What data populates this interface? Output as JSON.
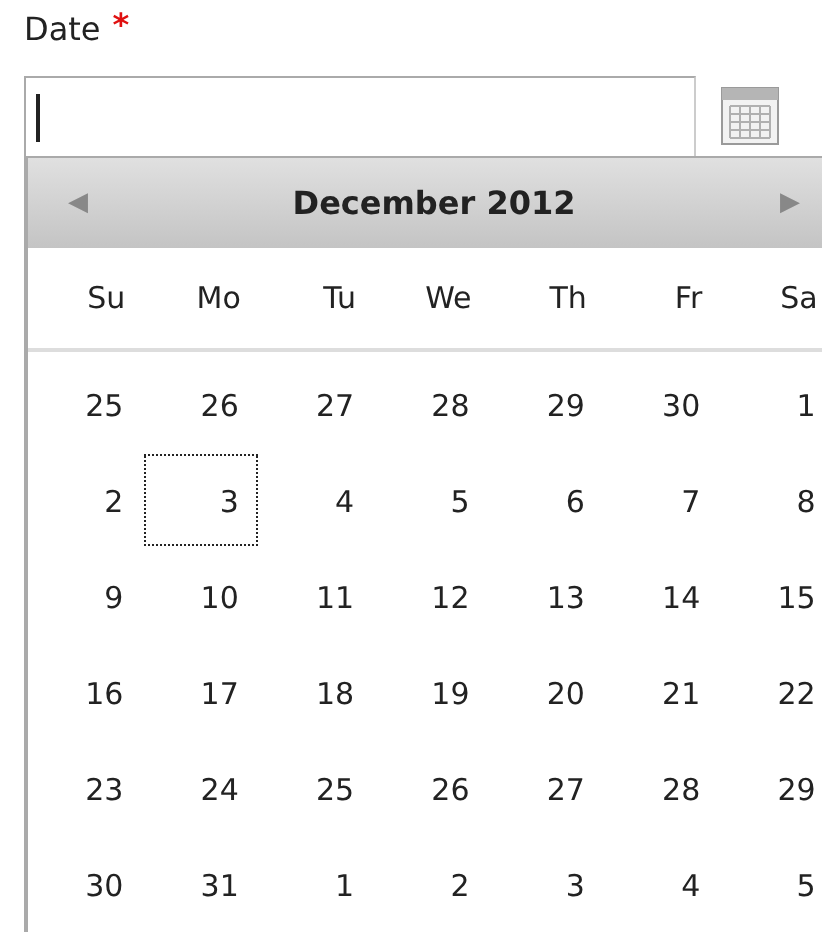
{
  "field": {
    "label": "Date",
    "required": true,
    "required_mark": "*"
  },
  "calendar": {
    "prev": "◀",
    "title": "December 2012",
    "next": "▶",
    "weekdays": [
      "Su",
      "Mo",
      "Tu",
      "We",
      "Th",
      "Fr",
      "Sa"
    ],
    "weeks": [
      [
        {
          "day": "25",
          "focused": false
        },
        {
          "day": "26",
          "focused": false
        },
        {
          "day": "27",
          "focused": false
        },
        {
          "day": "28",
          "focused": false
        },
        {
          "day": "29",
          "focused": false
        },
        {
          "day": "30",
          "focused": false
        },
        {
          "day": "1",
          "focused": false
        }
      ],
      [
        {
          "day": "2",
          "focused": false
        },
        {
          "day": "3",
          "focused": true
        },
        {
          "day": "4",
          "focused": false
        },
        {
          "day": "5",
          "focused": false
        },
        {
          "day": "6",
          "focused": false
        },
        {
          "day": "7",
          "focused": false
        },
        {
          "day": "8",
          "focused": false
        }
      ],
      [
        {
          "day": "9",
          "focused": false
        },
        {
          "day": "10",
          "focused": false
        },
        {
          "day": "11",
          "focused": false
        },
        {
          "day": "12",
          "focused": false
        },
        {
          "day": "13",
          "focused": false
        },
        {
          "day": "14",
          "focused": false
        },
        {
          "day": "15",
          "focused": false
        }
      ],
      [
        {
          "day": "16",
          "focused": false
        },
        {
          "day": "17",
          "focused": false
        },
        {
          "day": "18",
          "focused": false
        },
        {
          "day": "19",
          "focused": false
        },
        {
          "day": "20",
          "focused": false
        },
        {
          "day": "21",
          "focused": false
        },
        {
          "day": "22",
          "focused": false
        }
      ],
      [
        {
          "day": "23",
          "focused": false
        },
        {
          "day": "24",
          "focused": false
        },
        {
          "day": "25",
          "focused": false
        },
        {
          "day": "26",
          "focused": false
        },
        {
          "day": "27",
          "focused": false
        },
        {
          "day": "28",
          "focused": false
        },
        {
          "day": "29",
          "focused": false
        }
      ],
      [
        {
          "day": "30",
          "focused": false
        },
        {
          "day": "31",
          "focused": false
        },
        {
          "day": "1",
          "focused": false
        },
        {
          "day": "2",
          "focused": false
        },
        {
          "day": "3",
          "focused": false
        },
        {
          "day": "4",
          "focused": false
        },
        {
          "day": "5",
          "focused": false
        }
      ]
    ]
  }
}
